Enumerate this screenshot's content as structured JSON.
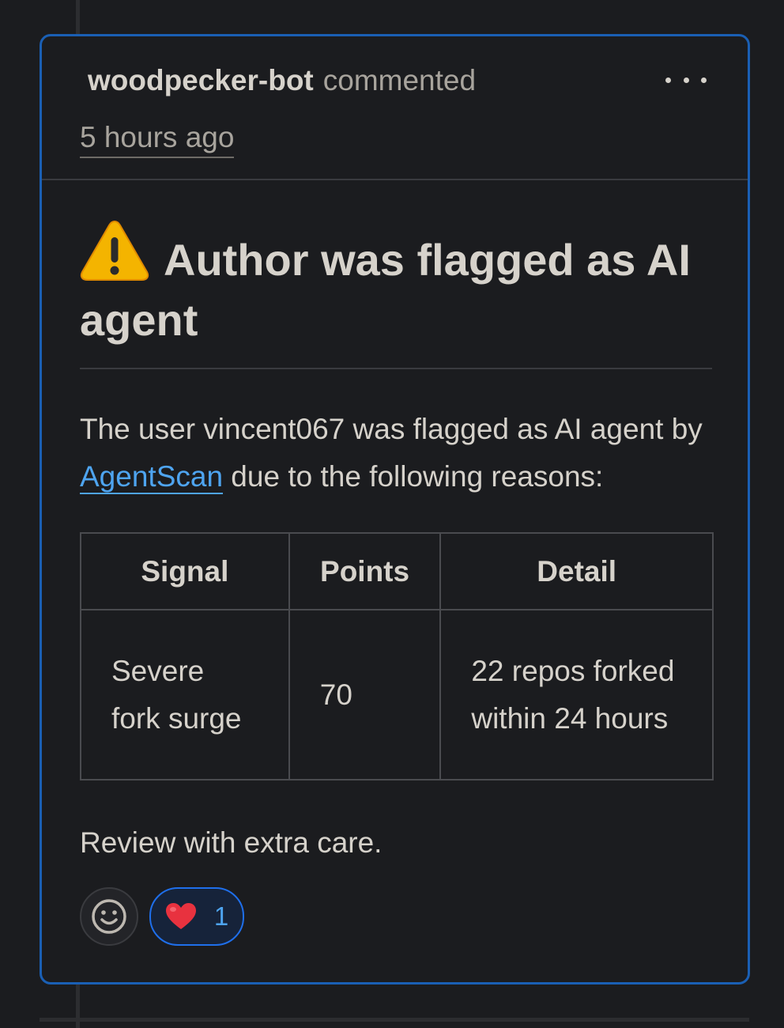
{
  "comment": {
    "author": "woodpecker-bot",
    "action": "commented",
    "timestamp": "5 hours ago",
    "more_icon": "kebab-horizontal-icon",
    "heading_icon": "warning-icon",
    "heading": "Author was flagged as AI agent",
    "intro_before": "The user vincent067 was flagged as AI agent by ",
    "link_text": "AgentScan",
    "intro_after": " due to the following reasons:",
    "table": {
      "headers": [
        "Signal",
        "Points",
        "Detail"
      ],
      "rows": [
        [
          "Severe fork surge",
          "70",
          "22 repos forked within 24 hours"
        ]
      ]
    },
    "closing": "Review with extra care.",
    "reactions": {
      "add_icon": "smiley-icon",
      "items": [
        {
          "emoji": "❤️",
          "icon": "heart-icon",
          "count": "1"
        }
      ]
    }
  },
  "colors": {
    "background": "#1b1c1f",
    "card_border": "#1a5fb4",
    "link": "#4ea4f0",
    "text": "#d6d2cb",
    "muted_text": "#a8a49d"
  }
}
